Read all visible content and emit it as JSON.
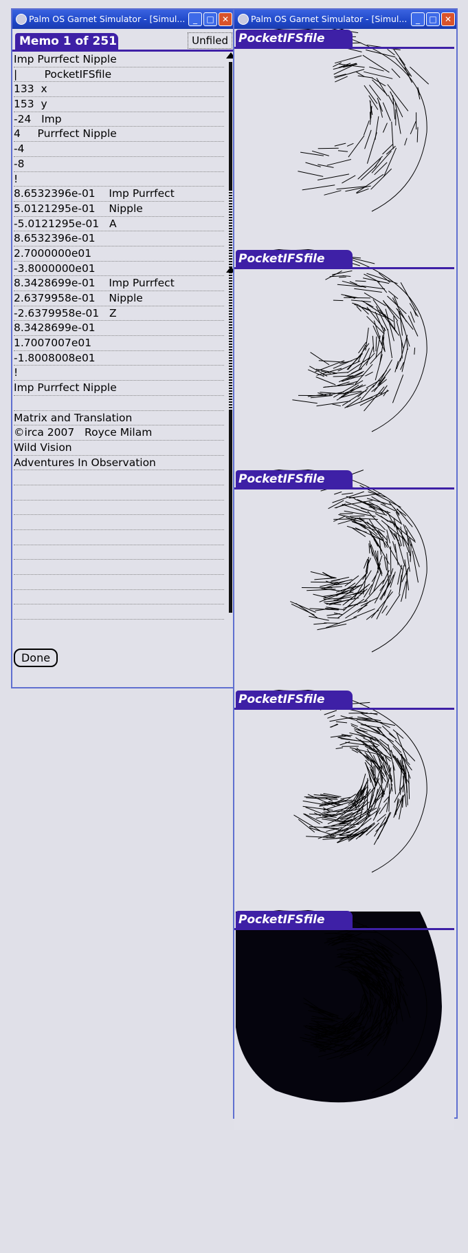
{
  "windows": [
    {
      "title": "Palm OS Garnet Simulator - [Simul...",
      "buttons": [
        "minimize",
        "maximize",
        "close"
      ]
    },
    {
      "title": "Palm OS Garnet Simulator - [Simul...",
      "buttons": [
        "minimize",
        "maximize",
        "close"
      ]
    }
  ],
  "memo": {
    "header": "Memo 1 of 251",
    "category": "Unfiled",
    "lines": [
      "Imp Purrfect Nipple",
      "|        PocketIFSfile",
      "133  x",
      "153  y",
      "-24   Imp",
      "4     Purrfect Nipple",
      "-4",
      "-8",
      "!",
      "8.6532396e-01    Imp Purrfect",
      "5.0121295e-01    Nipple",
      "-5.0121295e-01   A",
      "8.6532396e-01",
      "2.7000000e01",
      "-3.8000000e01",
      "8.3428699e-01    Imp Purrfect",
      "2.6379958e-01    Nipple",
      "-2.6379958e-01   Z",
      "8.3428699e-01",
      "1.7007007e01",
      "-1.8008008e01",
      "!",
      "Imp Purrfect Nipple",
      "",
      "Matrix and Translation",
      "©irca 2007   Royce Milam",
      "Wild Vision",
      "Adventures In Observation",
      "",
      "",
      "",
      "",
      "",
      "",
      "",
      "",
      "",
      ""
    ],
    "done_label": "Done"
  },
  "ifs": {
    "frame_title": "PocketIFSfile",
    "frames": [
      {
        "density": 0.12,
        "filled": false
      },
      {
        "density": 0.35,
        "filled": false
      },
      {
        "density": 0.55,
        "filled": false
      },
      {
        "density": 0.75,
        "filled": false
      },
      {
        "density": 1.0,
        "filled": true
      }
    ]
  },
  "colors": {
    "titlebar": "#1f47c8",
    "palm_header": "#3e20a6",
    "palm_bg": "#e1e1e9",
    "window_border": "#5f6fd0"
  }
}
